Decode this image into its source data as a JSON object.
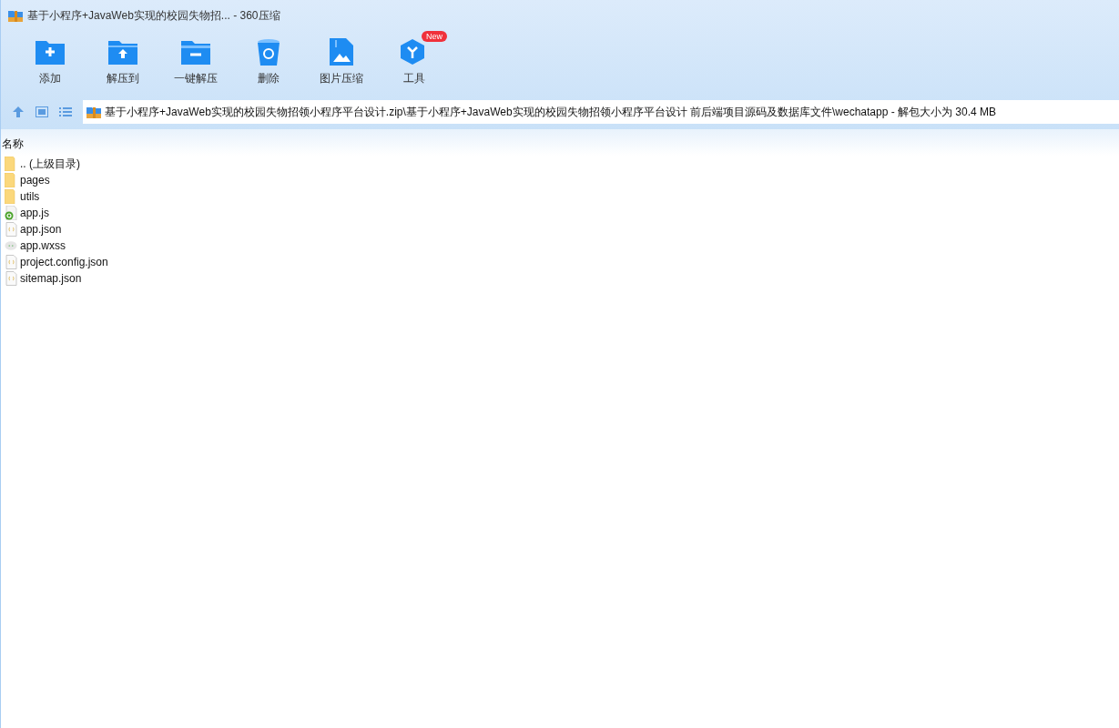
{
  "window": {
    "title": "基于小程序+JavaWeb实现的校园失物招... - 360压缩"
  },
  "toolbar": [
    {
      "kind": "add",
      "label": "添加"
    },
    {
      "kind": "extract-to",
      "label": "解压到"
    },
    {
      "kind": "quick-extract",
      "label": "一键解压"
    },
    {
      "kind": "delete",
      "label": "删除"
    },
    {
      "kind": "image",
      "label": "图片压缩"
    },
    {
      "kind": "tools",
      "label": "工具",
      "badge": "New"
    }
  ],
  "address": "基于小程序+JavaWeb实现的校园失物招领小程序平台设计.zip\\基于小程序+JavaWeb实现的校园失物招领小程序平台设计 前后端项目源码及数据库文件\\wechatapp - 解包大小为 30.4 MB",
  "list": {
    "columns": [
      "名称"
    ],
    "rows": [
      {
        "kind": "folder",
        "name": ".. (上级目录)"
      },
      {
        "kind": "folder",
        "name": "pages"
      },
      {
        "kind": "folder",
        "name": "utils"
      },
      {
        "kind": "js",
        "name": "app.js"
      },
      {
        "kind": "json",
        "name": "app.json"
      },
      {
        "kind": "wxss",
        "name": "app.wxss"
      },
      {
        "kind": "json",
        "name": "project.config.json"
      },
      {
        "kind": "json",
        "name": "sitemap.json"
      }
    ]
  }
}
